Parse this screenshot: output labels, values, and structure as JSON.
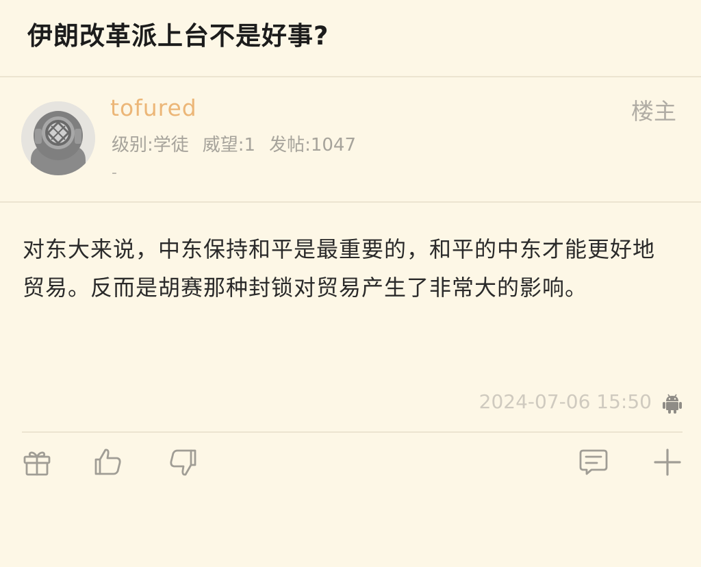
{
  "thread": {
    "title": "伊朗改革派上台不是好事?"
  },
  "post": {
    "username": "tofured",
    "level": "级别:学徒",
    "prestige": "威望:1",
    "post_count": "发帖:1047",
    "signature": "-",
    "floor_label": "楼主",
    "content": "对东大来说，中东保持和平是最重要的，和平的中东才能更好地贸易。反而是胡赛那种封锁对贸易产生了非常大的影响。",
    "timestamp": "2024-07-06 15:50",
    "device_icon": "android-icon"
  },
  "actions": {
    "icons": [
      "gift-icon",
      "thumbs-up-icon",
      "thumbs-down-icon",
      "comment-icon",
      "plus-icon"
    ]
  },
  "colors": {
    "background": "#fdf7e6",
    "username": "#ecb677",
    "meta_text": "#a6a39b",
    "divider": "#ece4d0"
  }
}
